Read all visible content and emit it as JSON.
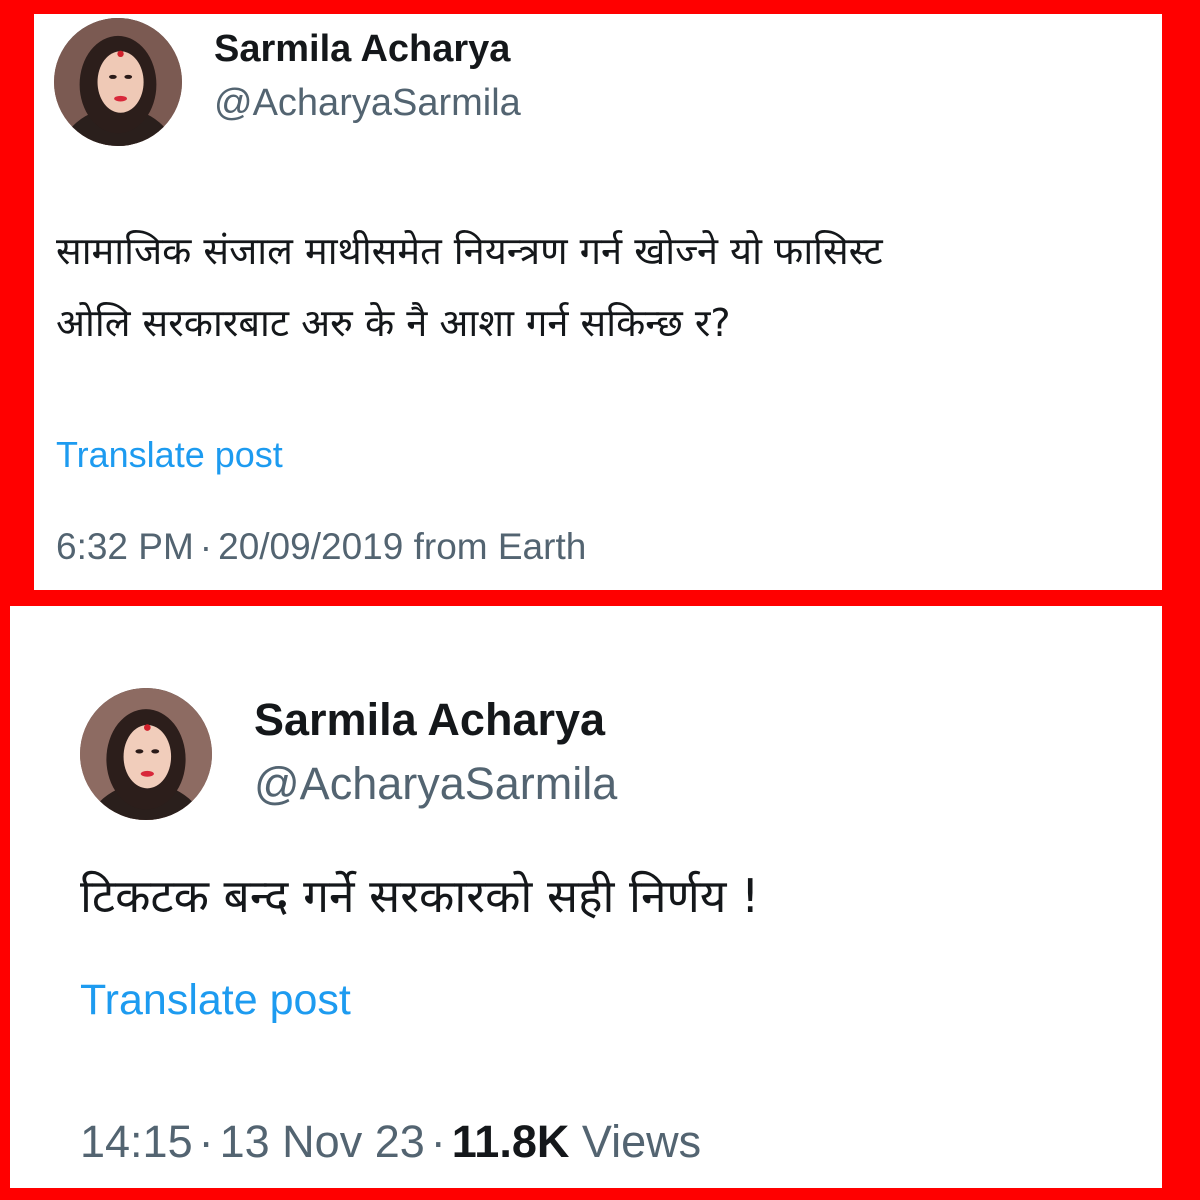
{
  "posts": [
    {
      "author_name": "Sarmila Acharya",
      "handle": "@AcharyaSarmila",
      "text_lines": [
        "सामाजिक संजाल माथीसमेत नियन्त्रण गर्न खोज्ने  यो फासिस्ट",
        "ओलि सरकारबाट अरु के नै आशा गर्न सकिन्छ र?"
      ],
      "translate_label": "Translate post",
      "time": "6:32 PM",
      "date": "20/09/2019",
      "source": "from Earth"
    },
    {
      "author_name": "Sarmila Acharya",
      "handle": "@AcharyaSarmila",
      "text_lines": [
        "टिकटक बन्द गर्ने सरकारको सही निर्णय !"
      ],
      "translate_label": "Translate post",
      "time": "14:15",
      "date": "13 Nov 23",
      "views_count": "11.8K",
      "views_label": "Views"
    }
  ],
  "separator": "·",
  "colors": {
    "frame_border": "#ff0000",
    "link": "#1d9bf0",
    "muted_text": "#536471",
    "text": "#14171a"
  }
}
